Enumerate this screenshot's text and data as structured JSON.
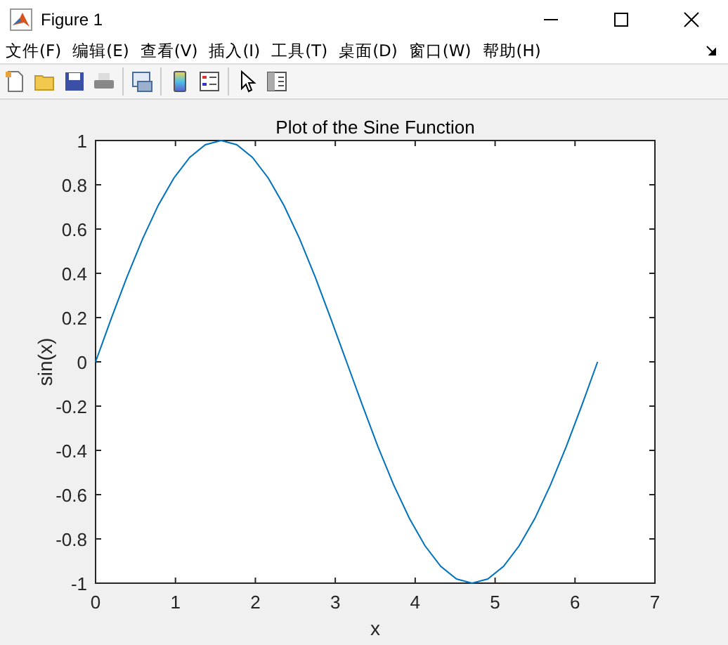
{
  "window": {
    "title": "Figure 1"
  },
  "menu": [
    "文件(F)",
    "编辑(E)",
    "查看(V)",
    "插入(I)",
    "工具(T)",
    "桌面(D)",
    "窗口(W)",
    "帮助(H)"
  ],
  "axes": {
    "chart_data": {
      "type": "line",
      "title": "Plot of the Sine Function",
      "xlabel": "x",
      "ylabel": "sin(x)",
      "x": [
        0,
        0.196,
        0.393,
        0.589,
        0.785,
        0.982,
        1.178,
        1.374,
        1.571,
        1.767,
        1.963,
        2.16,
        2.356,
        2.553,
        2.749,
        2.945,
        3.142,
        3.338,
        3.534,
        3.731,
        3.927,
        4.123,
        4.32,
        4.516,
        4.712,
        4.909,
        5.105,
        5.301,
        5.498,
        5.694,
        5.89,
        6.087,
        6.283
      ],
      "series": [
        {
          "color": "#0072bd",
          "values": [
            0,
            0.195,
            0.383,
            0.556,
            0.707,
            0.831,
            0.924,
            0.981,
            1,
            0.981,
            0.924,
            0.831,
            0.707,
            0.556,
            0.383,
            0.195,
            0,
            -0.195,
            -0.383,
            -0.556,
            -0.707,
            -0.831,
            -0.924,
            -0.981,
            -1,
            -0.981,
            -0.924,
            -0.831,
            -0.707,
            -0.556,
            -0.383,
            -0.195,
            0
          ]
        }
      ],
      "xlim": [
        0,
        7
      ],
      "ylim": [
        -1,
        1
      ],
      "xticks": [
        0,
        1,
        2,
        3,
        4,
        5,
        6,
        7
      ],
      "yticks": [
        -1,
        -0.8,
        -0.6,
        -0.4,
        -0.2,
        0,
        0.2,
        0.4,
        0.6,
        0.8,
        1
      ]
    }
  }
}
